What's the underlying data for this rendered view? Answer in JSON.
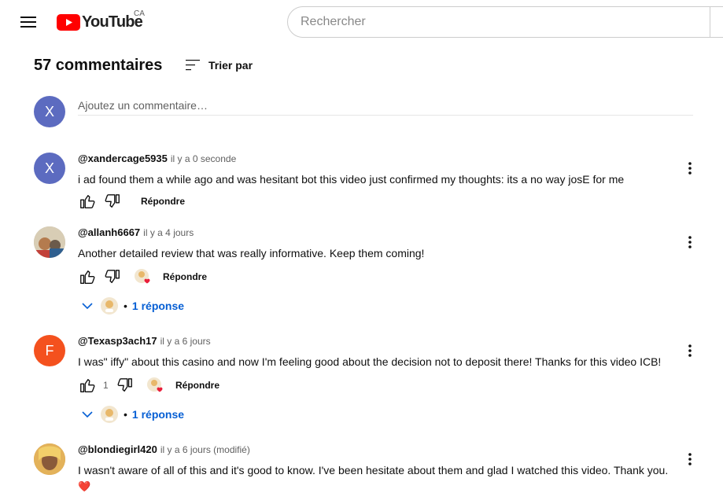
{
  "masthead": {
    "logo_text": "YouTube",
    "region": "CA",
    "search_placeholder": "Rechercher"
  },
  "comments": {
    "count_label": "57 commentaires",
    "sort_label": "Trier par",
    "add_placeholder": "Ajoutez un commentaire…",
    "viewer_initial": "X",
    "viewer_color": "#5c6bc0"
  },
  "reply_label": "Répondre",
  "threads": [
    {
      "author": "@xandercage5935",
      "time": "il y a 0 seconde",
      "text": "i ad found them a while ago and was hesitant bot this video just confirmed my thoughts: its a no way josE for me",
      "avatar_initial": "X",
      "avatar_color": "#5c6bc0",
      "likes": "",
      "creator_heart": false,
      "replies": ""
    },
    {
      "author": "@allanh6667",
      "time": "il y a 4 jours",
      "text": "Another detailed review that was really informative. Keep them coming!",
      "avatar_initial": "",
      "avatar_color": "#b0a58c",
      "likes": "",
      "creator_heart": true,
      "replies": "1 réponse"
    },
    {
      "author": "@Texasp3ach17",
      "time": "il y a 6 jours",
      "text": "I was\" iffy\" about this casino and now I'm feeling good about the decision not to deposit there! Thanks for this video ICB!",
      "avatar_initial": "F",
      "avatar_color": "#f4511e",
      "likes": "1",
      "creator_heart": true,
      "replies": "1 réponse"
    },
    {
      "author": "@blondiegirl420",
      "time": "il y a 6 jours (modifié)",
      "text": "I wasn't aware of all of this and it's good to know. I've been hesitate about them and glad I watched this video. Thank you.",
      "emoji": "❤️",
      "avatar_initial": "",
      "avatar_color": "#c9892b",
      "likes": "",
      "creator_heart": false,
      "replies": ""
    }
  ],
  "colors": {
    "link_blue": "#065fd4",
    "youtube_red": "#ff0000",
    "heart_red": "#e91e3a"
  }
}
